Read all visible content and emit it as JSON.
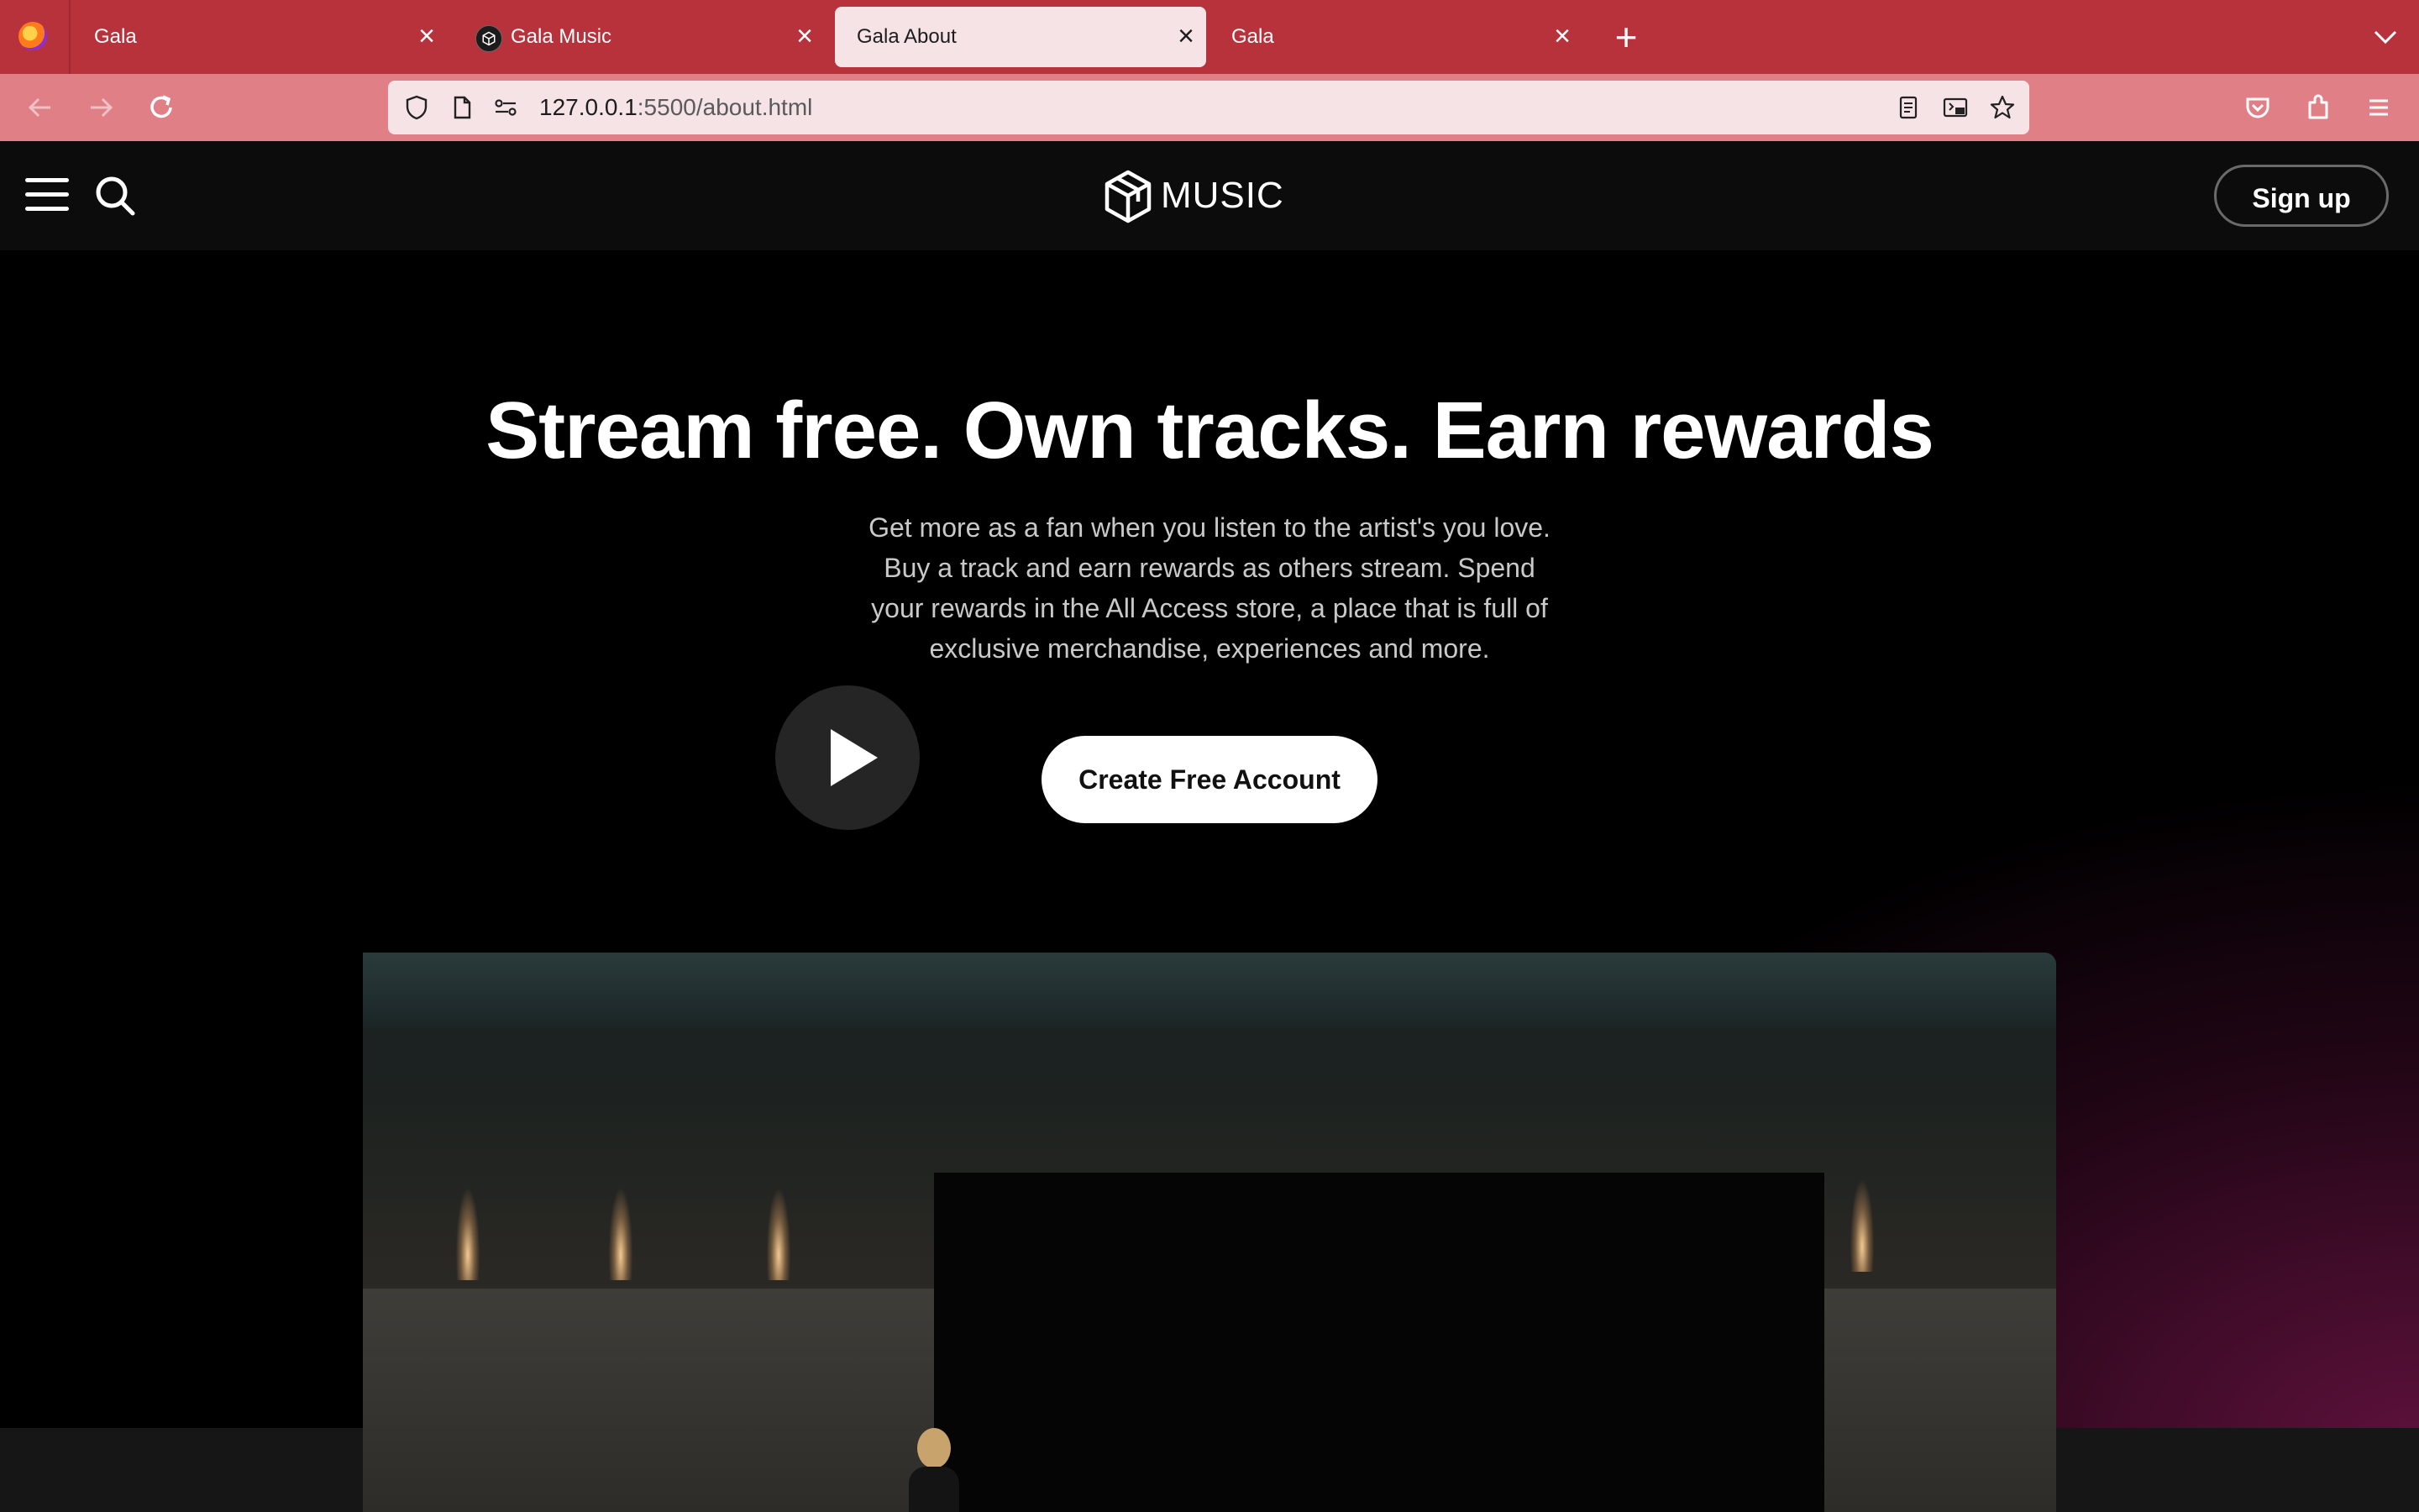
{
  "browser": {
    "tabs": [
      {
        "title": "Gala",
        "active": false,
        "has_icon": false
      },
      {
        "title": "Gala Music",
        "active": false,
        "has_icon": true
      },
      {
        "title": "Gala About",
        "active": true,
        "has_icon": false
      },
      {
        "title": "Gala",
        "active": false,
        "has_icon": false
      }
    ],
    "url_host": "127.0.0.1",
    "url_rest": ":5500/about.html",
    "colors": {
      "tabbar": "#b8323c",
      "navbar": "#e07f86",
      "urlbar": "#f6e3e6"
    }
  },
  "site": {
    "brand": "MUSIC",
    "signup_label": "Sign up"
  },
  "hero": {
    "title": "Stream free. Own tracks. Earn rewards",
    "subtitle": "Get more as a fan when you listen to the artist's you love. Buy a track and earn rewards as others stream. Spend your rewards in the All Access store, a place that is full of exclusive merchandise, experiences and more.",
    "cta_label": "Create Free Account"
  },
  "video": {
    "play_icon": "play-icon"
  }
}
